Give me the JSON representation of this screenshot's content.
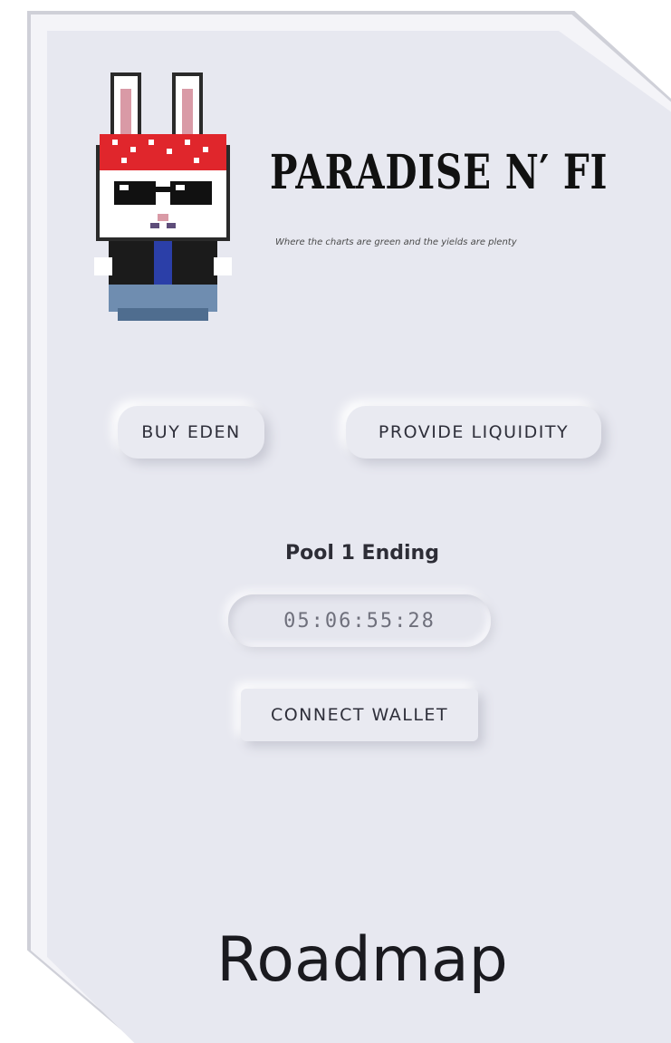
{
  "brand": {
    "title": "PARADISE N′ FI",
    "tagline": "Where the charts are green and the yields are plenty",
    "mascot_icon": "pixel-bunny-mascot-icon"
  },
  "actions": {
    "buy_label": "BUY EDEN",
    "liquidity_label": "PROVIDE LIQUIDITY",
    "connect_label": "CONNECT WALLET"
  },
  "pool": {
    "label": "Pool 1 Ending",
    "countdown": "05:06:55:28"
  },
  "footer": {
    "section_title": "Roadmap"
  },
  "colors": {
    "background": "#e7e8f0",
    "text": "#2e2f3a",
    "bandana": "#e0262c"
  }
}
